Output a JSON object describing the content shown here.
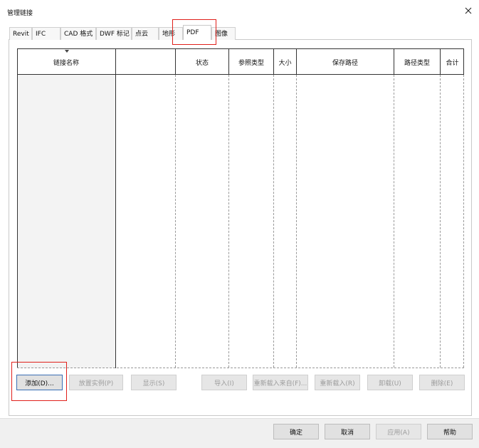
{
  "window": {
    "title": "管理链接",
    "close_glyph": "×"
  },
  "tabs": [
    {
      "label": "Revit"
    },
    {
      "label": "IFC"
    },
    {
      "label": "CAD 格式"
    },
    {
      "label": "DWF 标记"
    },
    {
      "label": "点云"
    },
    {
      "label": "地形"
    },
    {
      "label": "PDF",
      "active": true
    },
    {
      "label": "图像"
    }
  ],
  "table": {
    "columns": [
      "链接名称",
      "",
      "状态",
      "参照类型",
      "大小",
      "保存路径",
      "路径类型",
      "合计"
    ]
  },
  "actions": {
    "add": "添加(D)...",
    "place_instance": "放置实例(P)",
    "show": "显示(S)",
    "import": "导入(I)",
    "reload_from": "重新载入来自(F)...",
    "reload": "重新载入(R)",
    "unload": "卸载(U)",
    "delete": "删除(E)"
  },
  "footer": {
    "ok": "确定",
    "cancel": "取消",
    "apply": "应用(A)",
    "help": "帮助"
  },
  "colors": {
    "highlight": "#e0201b",
    "focus_border": "#3b6fb5"
  }
}
